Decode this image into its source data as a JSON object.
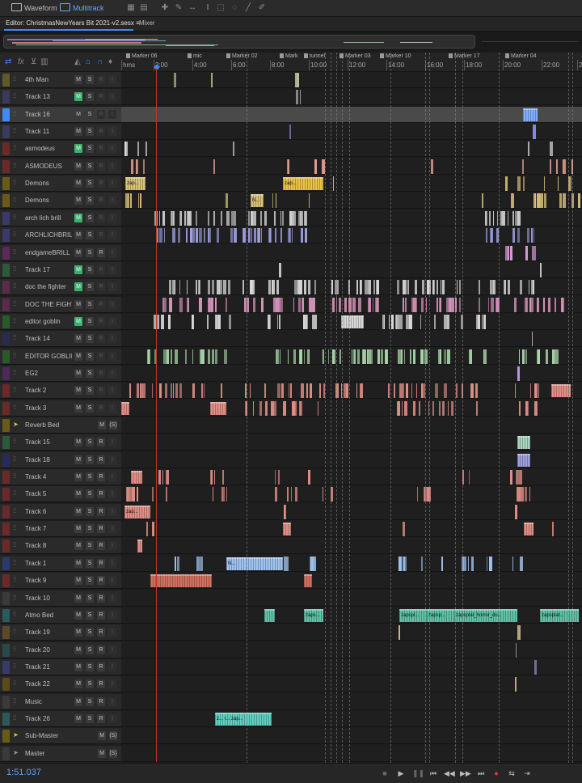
{
  "toolbar": {
    "waveform_label": "Waveform",
    "multitrack_label": "Multitrack"
  },
  "tabs": {
    "editor_label": "Editor: ChristmasNewYears Bit 2021-v2.sesx",
    "menu_glyph": "≡",
    "mixer_label": "Mixer"
  },
  "ruler": {
    "format_label": "hms",
    "ticks": [
      "2:00",
      "4:00",
      "6:00",
      "8:00",
      "10:00",
      "12:00",
      "14:00",
      "16:00",
      "18:00",
      "20:00",
      "22:00",
      "2"
    ],
    "markers": [
      "Marker 06",
      "mic",
      "Marker 02",
      "Mark",
      "tunnel",
      "Marker 03",
      "Marker 10",
      "Marker 17",
      "Marker 04"
    ]
  },
  "tracks": [
    {
      "name": "4th Man",
      "color": "#5e5a2a",
      "armed": false,
      "r": "R",
      "r_dim": true,
      "clips": "#c9c9a0"
    },
    {
      "name": "Track 13",
      "color": "#3a3a5a",
      "armed": true,
      "r": "R",
      "r_dim": true,
      "clips": "#bdbdbd"
    },
    {
      "name": "Track 16",
      "color": "#3d8bff",
      "armed": false,
      "r": "R",
      "r_dim": true,
      "clips": "#7fb0ff",
      "selected": true
    },
    {
      "name": "Track 11",
      "color": "#3a3a5a",
      "armed": false,
      "r": "R",
      "r_dim": true,
      "clips": "#8888dd"
    },
    {
      "name": "asmodeus",
      "color": "#6a2a2a",
      "armed": true,
      "r": "R",
      "r_dim": true,
      "clips": "#dcdcdc"
    },
    {
      "name": "ASMODEUS",
      "color": "#6a2a2a",
      "armed": false,
      "r": "R",
      "r_dim": true,
      "clips": "#e0a090"
    },
    {
      "name": "Demons",
      "color": "#6a5a1a",
      "armed": false,
      "r": "R",
      "r_dim": true,
      "clips": "#d8c27a"
    },
    {
      "name": "Demons",
      "color": "#6a5a1a",
      "armed": false,
      "r": "R",
      "r_dim": true,
      "clips": "#d8c27a"
    },
    {
      "name": "arch lich brill",
      "color": "#3a3a6a",
      "armed": true,
      "r": "R",
      "r_dim": true,
      "clips": "#d0d0d0"
    },
    {
      "name": "ARCHLICHBRILL",
      "color": "#3a3a6a",
      "armed": false,
      "r": "R",
      "r_dim": true,
      "clips": "#9f9fe0"
    },
    {
      "name": "endgameBRILL",
      "color": "#5a2a5a",
      "armed": false,
      "r": "R",
      "r_dim": false,
      "clips": "#d59ad5"
    },
    {
      "name": "Track 17",
      "color": "#2a5a3a",
      "armed": true,
      "r": "R",
      "r_dim": true,
      "clips": "#cfcfcf"
    },
    {
      "name": "doc the fighter",
      "color": "#5a2a4a",
      "armed": true,
      "r": "R",
      "r_dim": true,
      "clips": "#d6d6d6"
    },
    {
      "name": "DOC THE FIGHTER",
      "color": "#5a2a4a",
      "armed": false,
      "r": "R",
      "r_dim": true,
      "clips": "#d593b8"
    },
    {
      "name": "editor goblin",
      "color": "#2a5a2a",
      "armed": true,
      "r": "R",
      "r_dim": true,
      "clips": "#d8d8d8"
    },
    {
      "name": "Track 14",
      "color": "#2a2a4a",
      "armed": false,
      "r": "R",
      "r_dim": true,
      "clips": "#cfcfcf"
    },
    {
      "name": "EDITOR GOBLIN",
      "color": "#2a5a2a",
      "armed": false,
      "r": "R",
      "r_dim": true,
      "clips": "#a9d5a9"
    },
    {
      "name": "EG2",
      "color": "#4a2a5a",
      "armed": false,
      "r": "R",
      "r_dim": true,
      "clips": "#b99ae0"
    },
    {
      "name": "Track 2",
      "color": "#6a2a2a",
      "armed": false,
      "r": "R",
      "r_dim": true,
      "clips": "#e08f86"
    },
    {
      "name": "Track 3",
      "color": "#6a2a2a",
      "armed": false,
      "r": "R",
      "r_dim": true,
      "clips": "#e08f86"
    },
    {
      "name": "Reverb Bed",
      "color": "#6a5a1a",
      "bus": true,
      "clips": ""
    },
    {
      "name": "Track 15",
      "color": "#2a5a3a",
      "armed": false,
      "r": "R",
      "r_dim": false,
      "clips": "#a9d5c0"
    },
    {
      "name": "Track 18",
      "color": "#2a2a5a",
      "armed": false,
      "r": "R",
      "r_dim": false,
      "clips": "#9f9fe0"
    },
    {
      "name": "Track 4",
      "color": "#6a2a2a",
      "armed": false,
      "r": "R",
      "r_dim": false,
      "clips": "#e08f86"
    },
    {
      "name": "Track 5",
      "color": "#6a2a2a",
      "armed": false,
      "r": "R",
      "r_dim": false,
      "clips": "#e08f86"
    },
    {
      "name": "Track 6",
      "color": "#6a2a2a",
      "armed": false,
      "r": "R",
      "r_dim": false,
      "clips": "#e08f86"
    },
    {
      "name": "Track 7",
      "color": "#6a2a2a",
      "armed": false,
      "r": "R",
      "r_dim": false,
      "clips": "#e08f86"
    },
    {
      "name": "Track 8",
      "color": "#6a2a2a",
      "armed": false,
      "r": "R",
      "r_dim": false,
      "clips": "#e08f86"
    },
    {
      "name": "Track 1",
      "color": "#2a3a6a",
      "armed": false,
      "r": "R",
      "r_dim": false,
      "clips": "#9fc3f0"
    },
    {
      "name": "Track 9",
      "color": "#6a2a2a",
      "armed": false,
      "r": "R",
      "r_dim": false,
      "clips": "#d27060"
    },
    {
      "name": "Track 10",
      "color": "#3a3a3a",
      "armed": false,
      "r": "R",
      "r_dim": false,
      "clips": ""
    },
    {
      "name": "Atmo Bed",
      "color": "#2a5a5a",
      "armed": false,
      "r": "R",
      "r_dim": false,
      "clips": "#5fc2a6"
    },
    {
      "name": "Track 19",
      "color": "#5a4a2a",
      "armed": false,
      "r": "R",
      "r_dim": false,
      "clips": "#e0c090"
    },
    {
      "name": "Track 20",
      "color": "#2a4a4a",
      "armed": false,
      "r": "R",
      "r_dim": false,
      "clips": "#a9d5d5"
    },
    {
      "name": "Track 21",
      "color": "#3a3a6a",
      "armed": false,
      "r": "R",
      "r_dim": false,
      "clips": "#9f9fe0"
    },
    {
      "name": "Track 22",
      "color": "#5a4a1a",
      "armed": false,
      "r": "R",
      "r_dim": false,
      "clips": "#d8c27a"
    },
    {
      "name": "Music",
      "color": "#3a3a3a",
      "armed": false,
      "r": "R",
      "r_dim": false,
      "clips": ""
    },
    {
      "name": "Track 26",
      "color": "#2a5a5a",
      "armed": false,
      "r": "R",
      "r_dim": false,
      "clips": "#5fd0c0"
    },
    {
      "name": "Sub-Master",
      "color": "#6a5a1a",
      "bus": true,
      "clips": ""
    },
    {
      "name": "Master",
      "color": "#3a3a3a",
      "master": true,
      "clips": ""
    }
  ],
  "clip_labels": {
    "demons": "zap...",
    "demons2": "N...",
    "track6": "zap...",
    "track1": "N...",
    "atmo1": "zaps...",
    "atmo2": "zapspl...",
    "atmo3": "zapsp...",
    "atmo4": "zapsplat_horror_du...",
    "atmo5": "zapsplat...",
    "track26": "z... r... zap..."
  },
  "transport": {
    "timecode": "1:51.037"
  },
  "colors": {
    "accent": "#3d8bff",
    "playhead": "#c0392b",
    "armed": "#3fae6a"
  }
}
